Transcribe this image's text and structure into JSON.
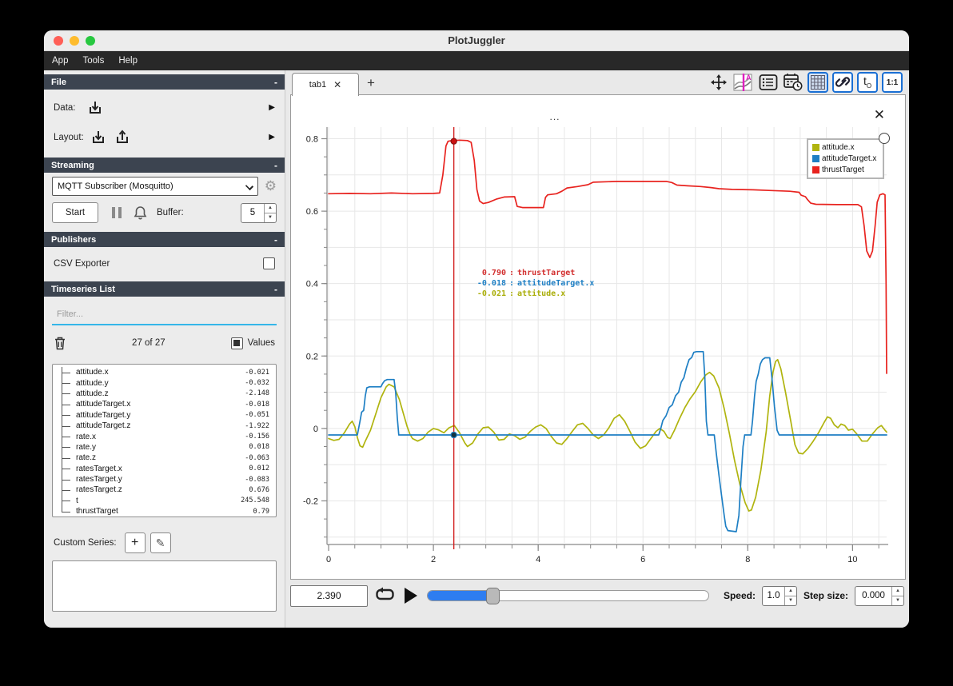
{
  "window": {
    "title": "PlotJuggler",
    "menu": [
      "App",
      "Tools",
      "Help"
    ]
  },
  "sidebar": {
    "file": {
      "header": "File",
      "collapse": "-",
      "data_label": "Data:",
      "layout_label": "Layout:",
      "arrow": "▶"
    },
    "streaming": {
      "header": "Streaming",
      "collapse": "-",
      "source_selected": "MQTT Subscriber (Mosquitto)",
      "start_label": "Start",
      "buffer_label": "Buffer:",
      "buffer_value": "5"
    },
    "publishers": {
      "header": "Publishers",
      "collapse": "-",
      "csv_label": "CSV Exporter"
    },
    "timeseries": {
      "header": "Timeseries List",
      "collapse": "-",
      "filter_placeholder": "Filter...",
      "count": "27 of 27",
      "values_label": "Values",
      "items": [
        {
          "name": "attitude.x",
          "value": "-0.021"
        },
        {
          "name": "attitude.y",
          "value": "-0.032"
        },
        {
          "name": "attitude.z",
          "value": "-2.148"
        },
        {
          "name": "attitudeTarget.x",
          "value": "-0.018"
        },
        {
          "name": "attitudeTarget.y",
          "value": "-0.051"
        },
        {
          "name": "attitudeTarget.z",
          "value": "-1.922"
        },
        {
          "name": "rate.x",
          "value": "-0.156"
        },
        {
          "name": "rate.y",
          "value": "0.018"
        },
        {
          "name": "rate.z",
          "value": "-0.063"
        },
        {
          "name": "ratesTarget.x",
          "value": "0.012"
        },
        {
          "name": "ratesTarget.y",
          "value": "-0.083"
        },
        {
          "name": "ratesTarget.z",
          "value": "0.676"
        },
        {
          "name": "t",
          "value": "245.548"
        },
        {
          "name": "thrustTarget",
          "value": "0.79"
        }
      ]
    },
    "custom_series": {
      "label": "Custom Series:",
      "add": "+",
      "edit": "✎"
    }
  },
  "tabs": {
    "active_label": "tab1",
    "close": "✕",
    "add": "+"
  },
  "toolbar": {
    "t0_label": "t",
    "t0_sub": "O",
    "ratio_label": "1:1"
  },
  "plot": {
    "title": "...",
    "close": "✕"
  },
  "playback": {
    "time": "2.390",
    "speed_label": "Speed:",
    "speed_value": "1.0",
    "step_label": "Step size:",
    "step_value": "0.000"
  },
  "chart_data": {
    "type": "line",
    "title": "...",
    "xlim": [
      0,
      10.65
    ],
    "ylim": [
      -0.316,
      0.832
    ],
    "xticks": [
      0,
      2,
      4,
      6,
      8,
      10
    ],
    "yticks": [
      0.8,
      0.6,
      0.4,
      0.2,
      0,
      -0.2
    ],
    "ytick_labels": [
      "0.8",
      "0.6",
      "0.4",
      "0.2",
      "0",
      "-0.2"
    ],
    "grid": {
      "x_step": 0.5,
      "y_step": 0.1,
      "color": "#e7e7e7"
    },
    "legend_position": "top-right",
    "series": [
      {
        "name": "attitude.x",
        "color": "#b0b40e",
        "points": [
          [
            0,
            -0.028
          ],
          [
            0.1,
            -0.033
          ],
          [
            0.2,
            -0.03
          ],
          [
            0.3,
            -0.012
          ],
          [
            0.4,
            0.012
          ],
          [
            0.45,
            0.02
          ],
          [
            0.5,
            0.005
          ],
          [
            0.55,
            -0.025
          ],
          [
            0.6,
            -0.048
          ],
          [
            0.65,
            -0.052
          ],
          [
            0.7,
            -0.035
          ],
          [
            0.8,
            -0.005
          ],
          [
            0.9,
            0.04
          ],
          [
            1,
            0.085
          ],
          [
            1.1,
            0.115
          ],
          [
            1.15,
            0.122
          ],
          [
            1.25,
            0.115
          ],
          [
            1.35,
            0.08
          ],
          [
            1.45,
            0.03
          ],
          [
            1.5,
            0.005
          ],
          [
            1.55,
            -0.015
          ],
          [
            1.6,
            -0.028
          ],
          [
            1.7,
            -0.035
          ],
          [
            1.8,
            -0.028
          ],
          [
            1.9,
            -0.01
          ],
          [
            2,
            0
          ],
          [
            2.1,
            -0.004
          ],
          [
            2.2,
            -0.012
          ],
          [
            2.3,
            0.002
          ],
          [
            2.4,
            0.008
          ],
          [
            2.5,
            -0.012
          ],
          [
            2.6,
            -0.04
          ],
          [
            2.65,
            -0.05
          ],
          [
            2.75,
            -0.04
          ],
          [
            2.85,
            -0.015
          ],
          [
            2.95,
            0.002
          ],
          [
            3.05,
            0.004
          ],
          [
            3.15,
            -0.01
          ],
          [
            3.25,
            -0.032
          ],
          [
            3.35,
            -0.03
          ],
          [
            3.45,
            -0.015
          ],
          [
            3.55,
            -0.02
          ],
          [
            3.65,
            -0.03
          ],
          [
            3.75,
            -0.024
          ],
          [
            3.85,
            -0.008
          ],
          [
            3.95,
            0.004
          ],
          [
            4.05,
            0.01
          ],
          [
            4.15,
            0
          ],
          [
            4.25,
            -0.022
          ],
          [
            4.35,
            -0.04
          ],
          [
            4.45,
            -0.044
          ],
          [
            4.55,
            -0.028
          ],
          [
            4.65,
            -0.008
          ],
          [
            4.75,
            0.01
          ],
          [
            4.85,
            0.014
          ],
          [
            4.95,
            0
          ],
          [
            5.05,
            -0.018
          ],
          [
            5.15,
            -0.028
          ],
          [
            5.25,
            -0.018
          ],
          [
            5.35,
            0.002
          ],
          [
            5.45,
            0.028
          ],
          [
            5.55,
            0.038
          ],
          [
            5.65,
            0.02
          ],
          [
            5.75,
            -0.008
          ],
          [
            5.85,
            -0.038
          ],
          [
            5.95,
            -0.055
          ],
          [
            6.05,
            -0.048
          ],
          [
            6.15,
            -0.028
          ],
          [
            6.25,
            -0.008
          ],
          [
            6.32,
            0
          ],
          [
            6.4,
            -0.008
          ],
          [
            6.47,
            -0.025
          ],
          [
            6.52,
            -0.028
          ],
          [
            6.6,
            -0.005
          ],
          [
            6.7,
            0.028
          ],
          [
            6.8,
            0.058
          ],
          [
            6.9,
            0.082
          ],
          [
            7,
            0.102
          ],
          [
            7.1,
            0.128
          ],
          [
            7.2,
            0.148
          ],
          [
            7.27,
            0.155
          ],
          [
            7.35,
            0.145
          ],
          [
            7.45,
            0.112
          ],
          [
            7.55,
            0.055
          ],
          [
            7.65,
            -0.015
          ],
          [
            7.75,
            -0.09
          ],
          [
            7.85,
            -0.155
          ],
          [
            7.95,
            -0.205
          ],
          [
            8.02,
            -0.228
          ],
          [
            8.07,
            -0.225
          ],
          [
            8.15,
            -0.19
          ],
          [
            8.25,
            -0.115
          ],
          [
            8.35,
            -0.01
          ],
          [
            8.42,
            0.09
          ],
          [
            8.48,
            0.155
          ],
          [
            8.53,
            0.185
          ],
          [
            8.57,
            0.19
          ],
          [
            8.63,
            0.165
          ],
          [
            8.72,
            0.1
          ],
          [
            8.82,
            0.02
          ],
          [
            8.9,
            -0.045
          ],
          [
            8.97,
            -0.068
          ],
          [
            9.05,
            -0.07
          ],
          [
            9.15,
            -0.055
          ],
          [
            9.25,
            -0.035
          ],
          [
            9.35,
            -0.012
          ],
          [
            9.45,
            0.015
          ],
          [
            9.52,
            0.032
          ],
          [
            9.58,
            0.028
          ],
          [
            9.65,
            0.01
          ],
          [
            9.72,
            0.002
          ],
          [
            9.78,
            0.012
          ],
          [
            9.85,
            0.008
          ],
          [
            9.92,
            -0.005
          ],
          [
            10,
            -0.002
          ],
          [
            10.08,
            -0.015
          ],
          [
            10.18,
            -0.035
          ],
          [
            10.28,
            -0.035
          ],
          [
            10.38,
            -0.015
          ],
          [
            10.48,
            0.002
          ],
          [
            10.55,
            0.008
          ],
          [
            10.62,
            -0.005
          ],
          [
            10.65,
            -0.01
          ]
        ]
      },
      {
        "name": "attitudeTarget.x",
        "color": "#1e7fc4",
        "points": [
          [
            0,
            -0.018
          ],
          [
            0.55,
            -0.018
          ],
          [
            0.58,
            0.005
          ],
          [
            0.6,
            0.02
          ],
          [
            0.63,
            0.045
          ],
          [
            0.67,
            0.05
          ],
          [
            0.7,
            0.09
          ],
          [
            0.73,
            0.112
          ],
          [
            0.78,
            0.115
          ],
          [
            1,
            0.115
          ],
          [
            1.03,
            0.124
          ],
          [
            1.07,
            0.132
          ],
          [
            1.12,
            0.135
          ],
          [
            1.25,
            0.135
          ],
          [
            1.28,
            0.1
          ],
          [
            1.31,
            0.03
          ],
          [
            1.34,
            -0.018
          ],
          [
            6.3,
            -0.018
          ],
          [
            6.34,
            0
          ],
          [
            6.38,
            0.022
          ],
          [
            6.44,
            0.035
          ],
          [
            6.5,
            0.058
          ],
          [
            6.56,
            0.065
          ],
          [
            6.62,
            0.09
          ],
          [
            6.68,
            0.1
          ],
          [
            6.73,
            0.128
          ],
          [
            6.78,
            0.14
          ],
          [
            6.83,
            0.168
          ],
          [
            6.88,
            0.19
          ],
          [
            6.93,
            0.196
          ],
          [
            6.97,
            0.21
          ],
          [
            7.02,
            0.212
          ],
          [
            7.15,
            0.212
          ],
          [
            7.18,
            0.14
          ],
          [
            7.21,
            0.02
          ],
          [
            7.24,
            -0.018
          ],
          [
            7.36,
            -0.018
          ],
          [
            7.4,
            -0.07
          ],
          [
            7.45,
            -0.13
          ],
          [
            7.5,
            -0.185
          ],
          [
            7.55,
            -0.24
          ],
          [
            7.58,
            -0.27
          ],
          [
            7.62,
            -0.282
          ],
          [
            7.78,
            -0.285
          ],
          [
            7.83,
            -0.24
          ],
          [
            7.87,
            -0.14
          ],
          [
            7.91,
            -0.05
          ],
          [
            7.94,
            -0.018
          ],
          [
            8.06,
            -0.018
          ],
          [
            8.09,
            0.02
          ],
          [
            8.13,
            0.09
          ],
          [
            8.16,
            0.13
          ],
          [
            8.2,
            0.15
          ],
          [
            8.24,
            0.178
          ],
          [
            8.28,
            0.19
          ],
          [
            8.33,
            0.195
          ],
          [
            8.42,
            0.195
          ],
          [
            8.46,
            0.14
          ],
          [
            8.51,
            0.06
          ],
          [
            8.56,
            -0.005
          ],
          [
            8.6,
            -0.018
          ],
          [
            10.65,
            -0.018
          ]
        ]
      },
      {
        "name": "thrustTarget",
        "color": "#e8231f",
        "points": [
          [
            0,
            0.648
          ],
          [
            0.4,
            0.649
          ],
          [
            0.8,
            0.648
          ],
          [
            1.2,
            0.65
          ],
          [
            1.6,
            0.648
          ],
          [
            2,
            0.649
          ],
          [
            2.12,
            0.65
          ],
          [
            2.18,
            0.7
          ],
          [
            2.24,
            0.78
          ],
          [
            2.28,
            0.793
          ],
          [
            2.35,
            0.795
          ],
          [
            2.5,
            0.796
          ],
          [
            2.65,
            0.795
          ],
          [
            2.72,
            0.79
          ],
          [
            2.78,
            0.74
          ],
          [
            2.83,
            0.66
          ],
          [
            2.88,
            0.628
          ],
          [
            2.95,
            0.621
          ],
          [
            3.05,
            0.624
          ],
          [
            3.2,
            0.633
          ],
          [
            3.35,
            0.639
          ],
          [
            3.55,
            0.64
          ],
          [
            3.6,
            0.613
          ],
          [
            3.7,
            0.61
          ],
          [
            4.1,
            0.61
          ],
          [
            4.14,
            0.638
          ],
          [
            4.18,
            0.645
          ],
          [
            4.35,
            0.648
          ],
          [
            4.45,
            0.655
          ],
          [
            4.55,
            0.664
          ],
          [
            4.75,
            0.668
          ],
          [
            4.95,
            0.673
          ],
          [
            5.05,
            0.68
          ],
          [
            5.5,
            0.682
          ],
          [
            6,
            0.682
          ],
          [
            6.45,
            0.682
          ],
          [
            6.55,
            0.679
          ],
          [
            6.65,
            0.672
          ],
          [
            6.85,
            0.67
          ],
          [
            7.1,
            0.668
          ],
          [
            7.3,
            0.665
          ],
          [
            7.45,
            0.662
          ],
          [
            7.7,
            0.66
          ],
          [
            8.1,
            0.659
          ],
          [
            8.45,
            0.657
          ],
          [
            8.8,
            0.655
          ],
          [
            8.98,
            0.652
          ],
          [
            9.02,
            0.644
          ],
          [
            9.1,
            0.64
          ],
          [
            9.14,
            0.632
          ],
          [
            9.2,
            0.622
          ],
          [
            9.3,
            0.619
          ],
          [
            9.7,
            0.618
          ],
          [
            10.1,
            0.618
          ],
          [
            10.17,
            0.612
          ],
          [
            10.22,
            0.56
          ],
          [
            10.27,
            0.49
          ],
          [
            10.33,
            0.472
          ],
          [
            10.38,
            0.49
          ],
          [
            10.43,
            0.56
          ],
          [
            10.47,
            0.625
          ],
          [
            10.52,
            0.645
          ],
          [
            10.58,
            0.648
          ],
          [
            10.62,
            0.645
          ],
          [
            10.64,
            0.4
          ],
          [
            10.65,
            0.152
          ]
        ]
      }
    ],
    "tracker": {
      "x": 2.39,
      "color": "#d21f1f",
      "dots": [
        {
          "y": 0.793,
          "fill": "#cc1111",
          "stroke": "#881111"
        },
        {
          "y": -0.018,
          "fill": "#14333f",
          "stroke": "#1e7fc4"
        }
      ],
      "lines": [
        {
          "value": " 0.790",
          "name": "thrustTarget",
          "color": "#d22f2f"
        },
        {
          "value": "-0.018",
          "name": "attitudeTarget.x",
          "color": "#1e7fc4"
        },
        {
          "value": "-0.021",
          "name": "attitude.x",
          "color": "#aaae0a"
        }
      ]
    }
  }
}
